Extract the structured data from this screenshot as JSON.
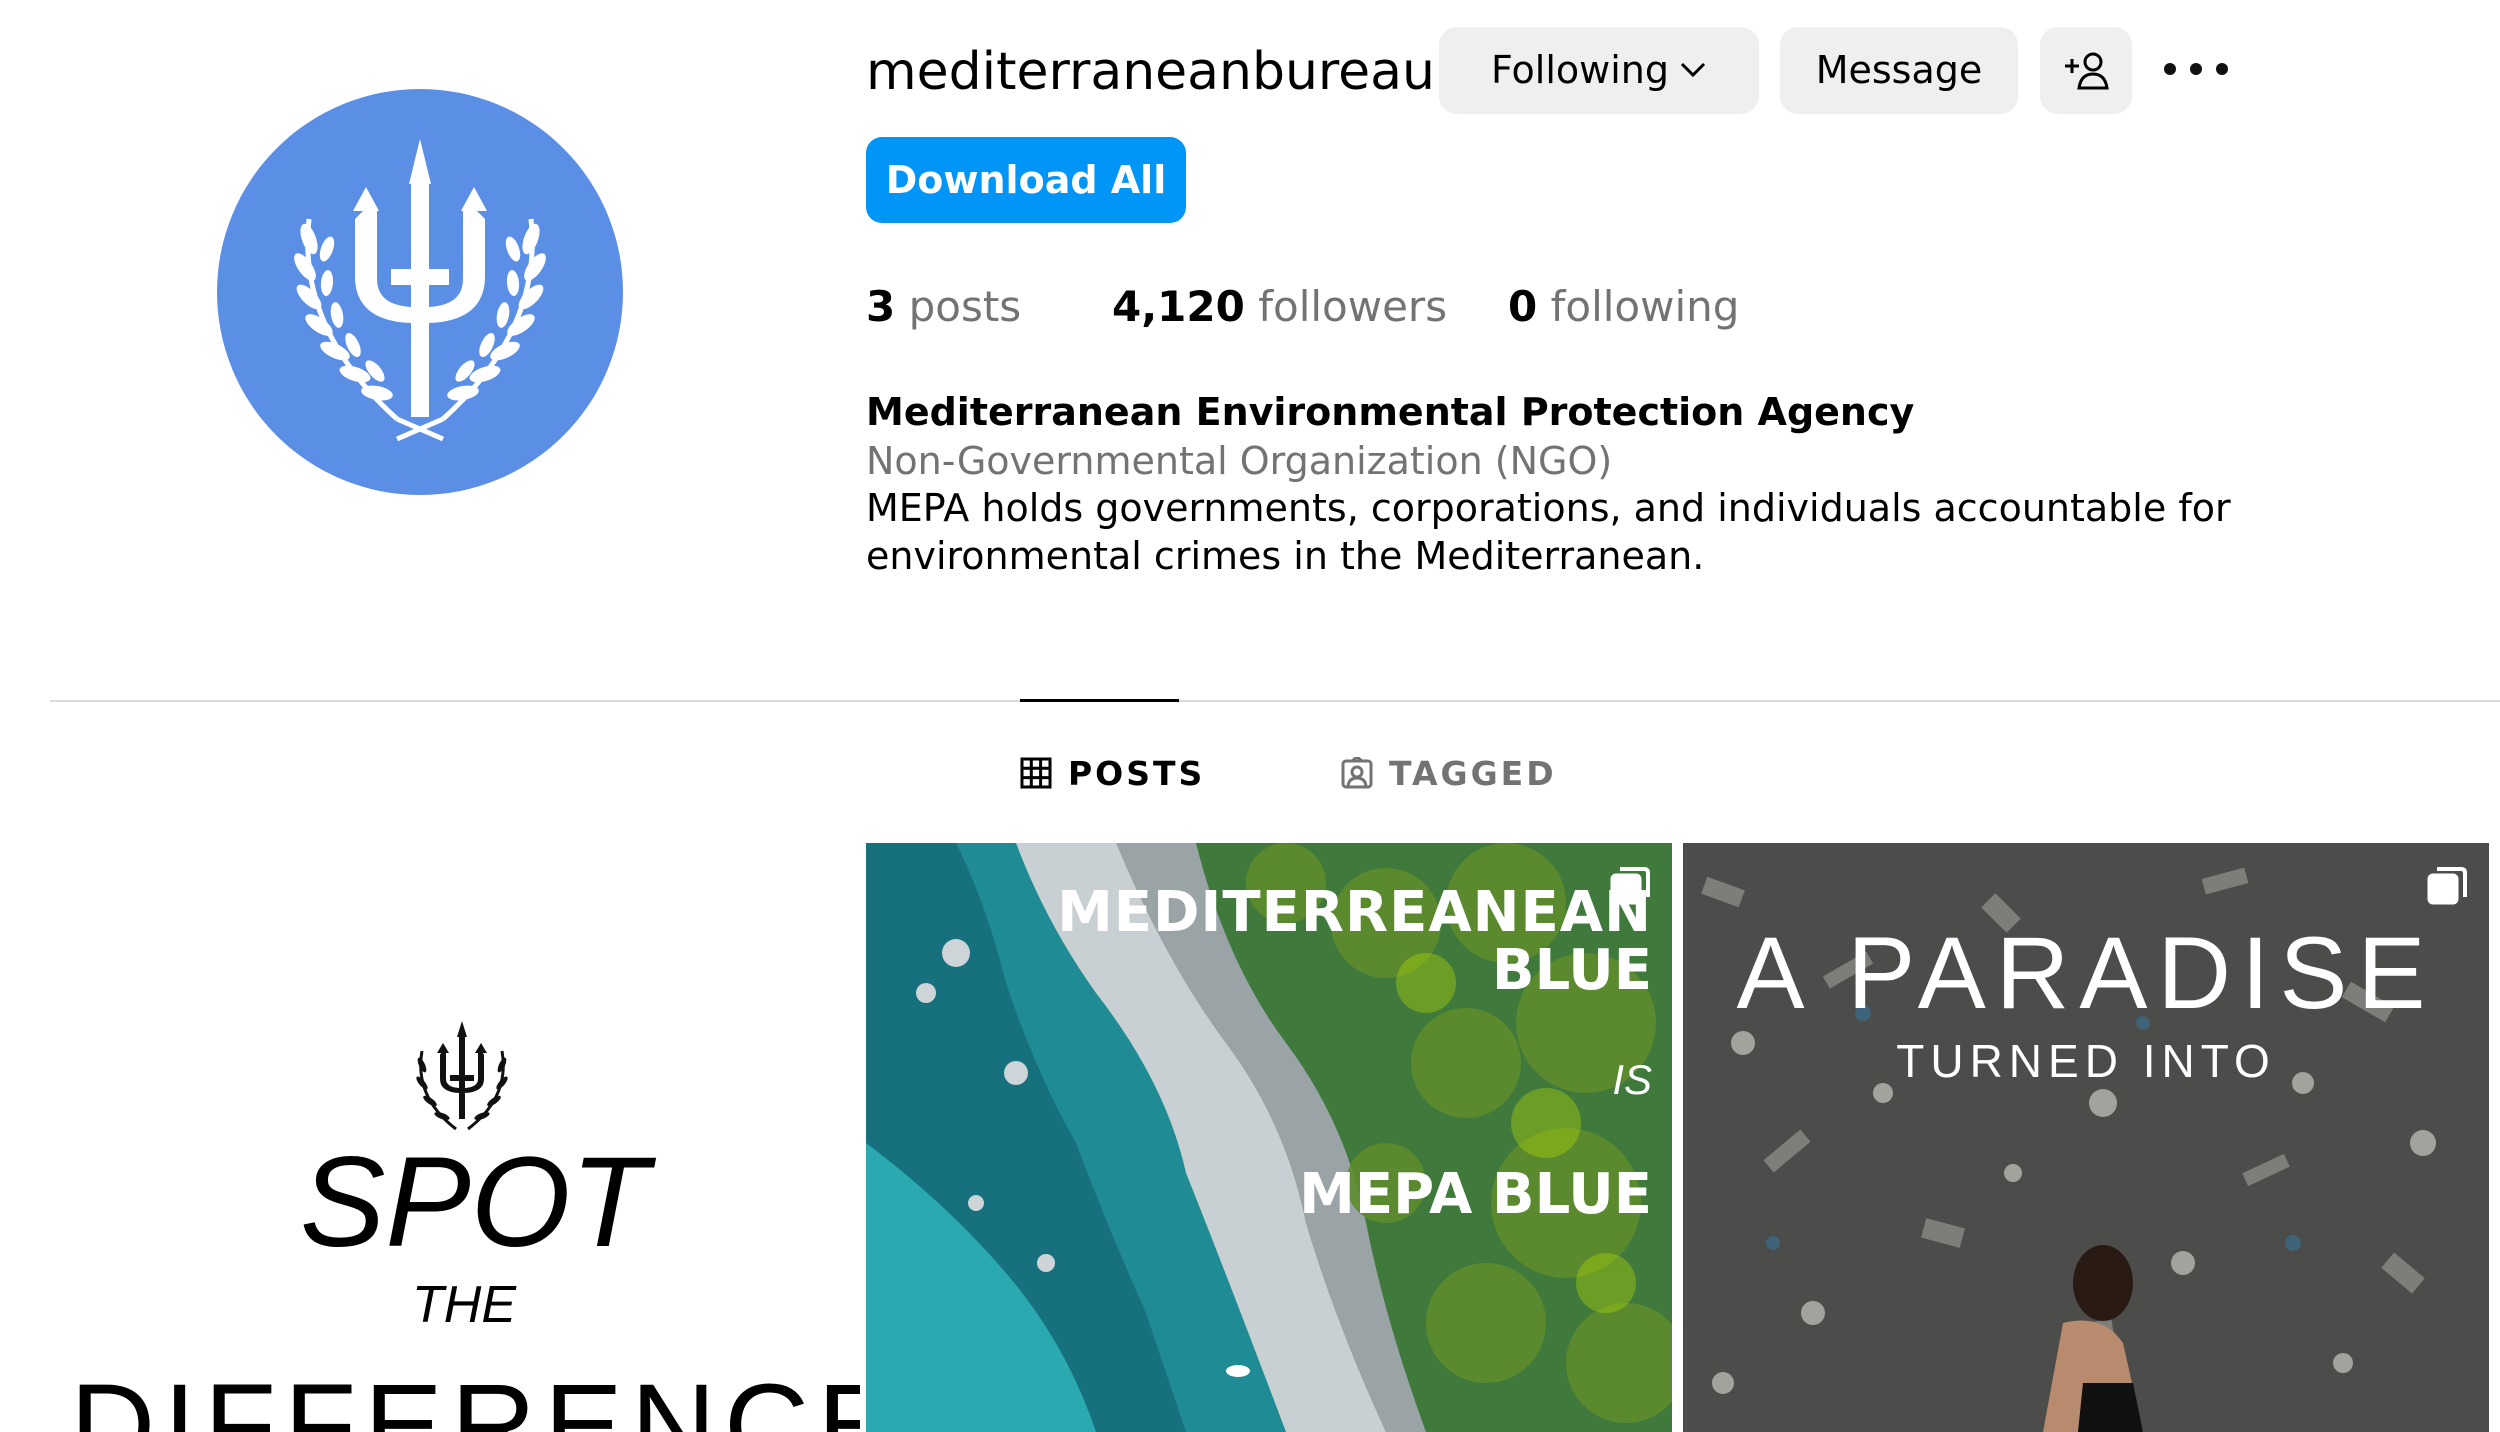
{
  "profile": {
    "username": "mediterraneanbureau",
    "following_button": "Following",
    "message_button": "Message",
    "download_button": "Download All",
    "avatar_color": "#5b8fe6"
  },
  "stats": {
    "posts_count": "3",
    "posts_label": "posts",
    "followers_count": "4,120",
    "followers_label": "followers",
    "following_count": "0",
    "following_label": "following"
  },
  "bio": {
    "name": "Mediterranean Environmental Protection Agency",
    "category": "Non-Governmental Organization (NGO)",
    "text": "MEPA holds governments, corporations, and individuals accountable for environmental crimes in the Mediterranean."
  },
  "tabs": [
    {
      "label": "POSTS",
      "icon": "grid-icon",
      "active": true
    },
    {
      "label": "TAGGED",
      "icon": "tagged-icon",
      "active": false
    }
  ],
  "posts": [
    {
      "title": "SPOT",
      "subtitle": "THE",
      "bottom": "DIFFERENCES"
    },
    {
      "line1": "MEDITERREANEAN",
      "line2": "BLUE",
      "line3": "IS",
      "line4": "MEPA BLUE",
      "icon": "carousel-icon"
    },
    {
      "line1": "A PARADISE",
      "line2": "TURNED INTO",
      "icon": "carousel-icon"
    }
  ],
  "colors": {
    "primary_button": "#0095f6",
    "secondary_button": "#efefef",
    "muted_text": "#737373",
    "divider": "#dbdbdb"
  }
}
